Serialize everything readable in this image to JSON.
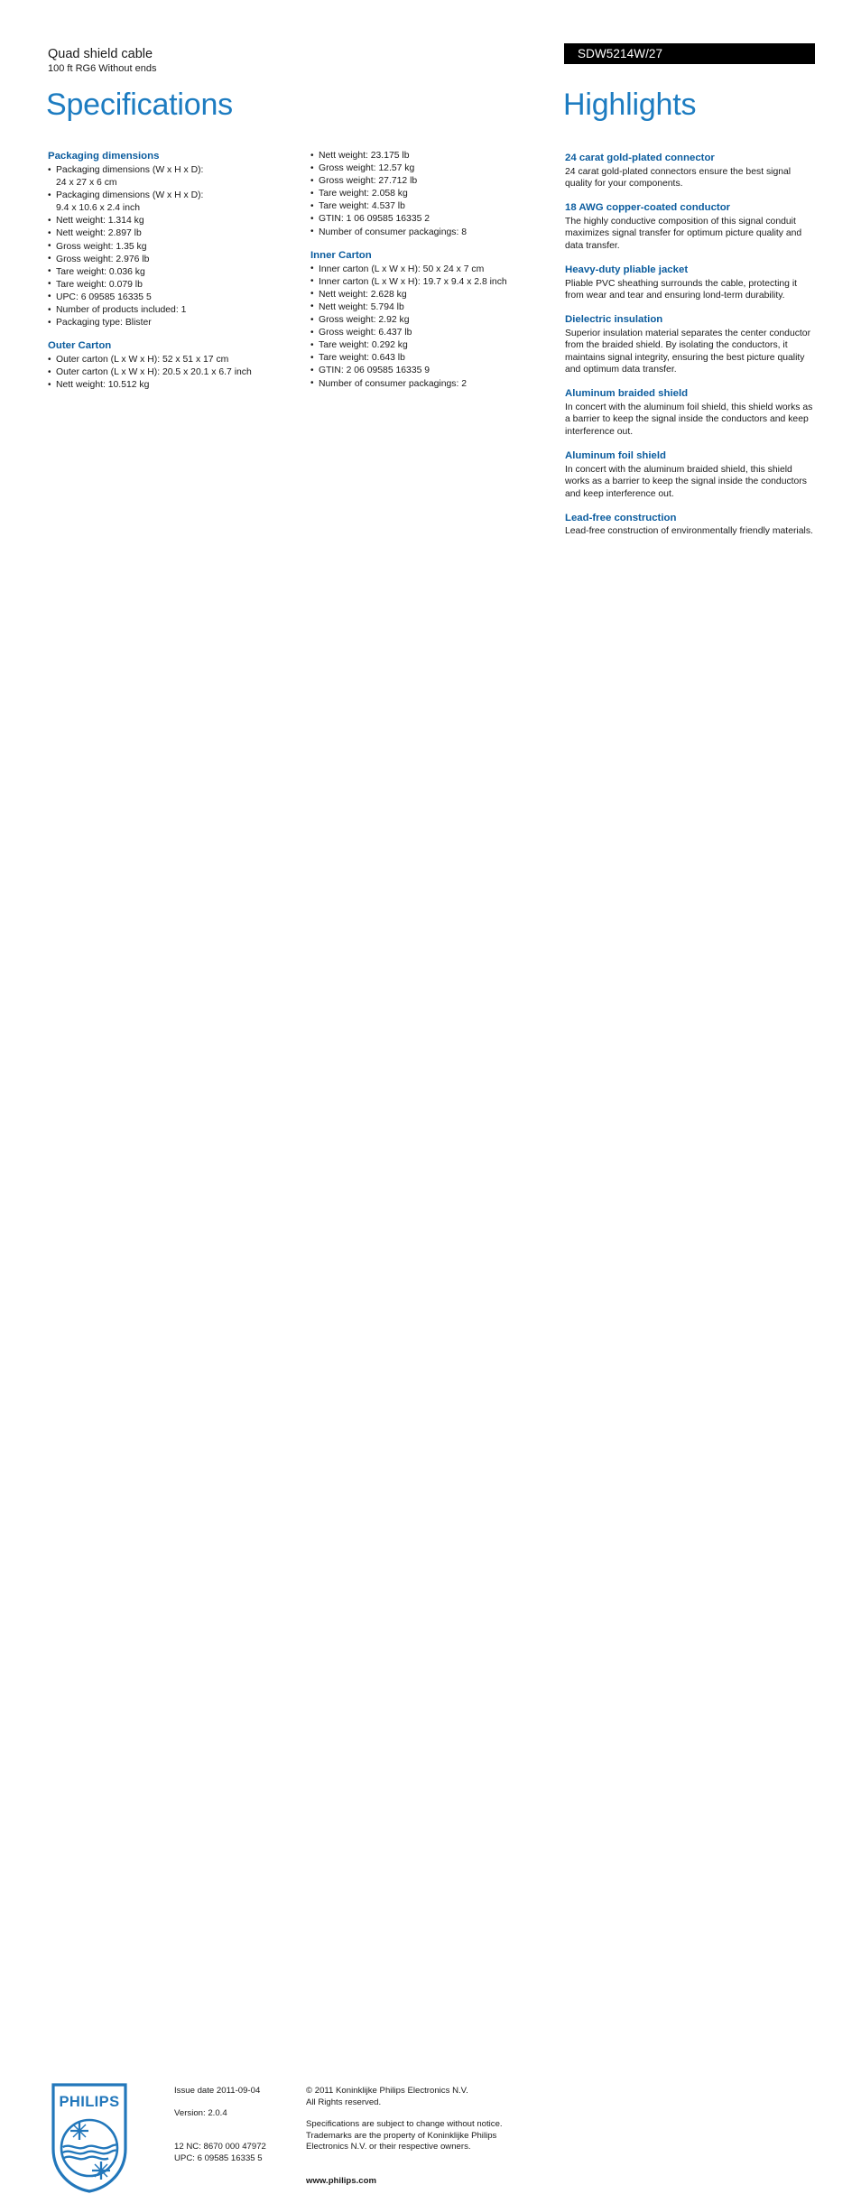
{
  "header": {
    "product_name": "Quad shield cable",
    "product_subtitle": "100 ft RG6 Without ends",
    "model_code": "SDW5214W/27",
    "specifications_heading": "Specifications",
    "highlights_heading": "Highlights"
  },
  "colors": {
    "page_heading_blue": "#1d7cc1",
    "section_heading_blue": "#0b5c9e",
    "model_bar_background": "#000000",
    "model_code_text": "#ffffff",
    "body_text": "#1a1a1a",
    "logo_blue": "#2277bb"
  },
  "specifications": {
    "column_1": [
      {
        "title": "Packaging dimensions",
        "items": [
          "Packaging dimensions (W x H x D):",
          "24 x 27 x 6 cm",
          "Packaging dimensions (W x H x D):",
          "9.4 x 10.6 x 2.4 inch",
          "Nett weight: 1.314 kg",
          "Nett weight: 2.897 lb",
          "Gross weight: 1.35 kg",
          "Gross weight: 2.976 lb",
          "Tare weight: 0.036 kg",
          "Tare weight: 0.079 lb",
          "UPC: 6 09585 16335 5",
          "Number of products included: 1",
          "Packaging type: Blister"
        ],
        "continuation_indices": [
          1,
          3
        ]
      },
      {
        "title": "Outer Carton",
        "items": [
          "Outer carton (L x W x H): 52 x 51 x 17 cm",
          "Outer carton (L x W x H): 20.5 x 20.1 x 6.7 inch",
          "Nett weight: 10.512 kg"
        ],
        "continuation_indices": []
      }
    ],
    "column_2": [
      {
        "title": "",
        "items": [
          "Nett weight: 23.175 lb",
          "Gross weight: 12.57 kg",
          "Gross weight: 27.712 lb",
          "Tare weight: 2.058 kg",
          "Tare weight: 4.537 lb",
          "GTIN: 1 06 09585 16335 2",
          "Number of consumer packagings: 8"
        ],
        "continuation_indices": []
      },
      {
        "title": "Inner Carton",
        "items": [
          "Inner carton (L x W x H): 50 x 24 x 7 cm",
          "Inner carton (L x W x H): 19.7 x 9.4 x 2.8 inch",
          "Nett weight: 2.628 kg",
          "Nett weight: 5.794 lb",
          "Gross weight: 2.92 kg",
          "Gross weight: 6.437 lb",
          "Tare weight: 0.292 kg",
          "Tare weight: 0.643 lb",
          "GTIN: 2 06 09585 16335 9",
          "Number of consumer packagings: 2"
        ],
        "continuation_indices": []
      }
    ]
  },
  "highlights": [
    {
      "title": "24 carat gold-plated connector",
      "body": "24 carat gold-plated connectors ensure the best signal quality for your components."
    },
    {
      "title": "18 AWG copper-coated conductor",
      "body": "The highly conductive composition of this signal conduit maximizes signal transfer for optimum picture quality and data transfer."
    },
    {
      "title": "Heavy-duty pliable jacket",
      "body": "Pliable PVC sheathing surrounds the cable, protecting it from wear and tear and ensuring lond-term durability."
    },
    {
      "title": "Dielectric insulation",
      "body": "Superior insulation material separates the center conductor from the braided shield. By isolating the conductors, it maintains signal integrity, ensuring the best picture quality and optimum data transfer."
    },
    {
      "title": "Aluminum braided shield",
      "body": "In concert with the aluminum foil shield, this shield works as a barrier to keep the signal inside the conductors and keep interference out."
    },
    {
      "title": "Aluminum foil shield",
      "body": "In concert with the aluminum braided shield, this shield works as a barrier to keep the signal inside the conductors and keep interference out."
    },
    {
      "title": "Lead-free construction",
      "body": "Lead-free construction of environmentally friendly materials."
    }
  ],
  "footer": {
    "logo_wordmark": "PHILIPS",
    "issue_date": "Issue date 2011-09-04",
    "version": "Version: 2.0.4",
    "nc_code": "12 NC: 8670 000 47972",
    "upc": "UPC: 6 09585 16335 5",
    "copyright_line_1": "© 2011 Koninklijke Philips Electronics N.V.",
    "copyright_line_2": "All Rights reserved.",
    "disclaimer_line_1": "Specifications are subject to change without notice.",
    "disclaimer_line_2": "Trademarks are the property of Koninklijke Philips",
    "disclaimer_line_3": "Electronics N.V. or their respective owners.",
    "website": "www.philips.com"
  }
}
